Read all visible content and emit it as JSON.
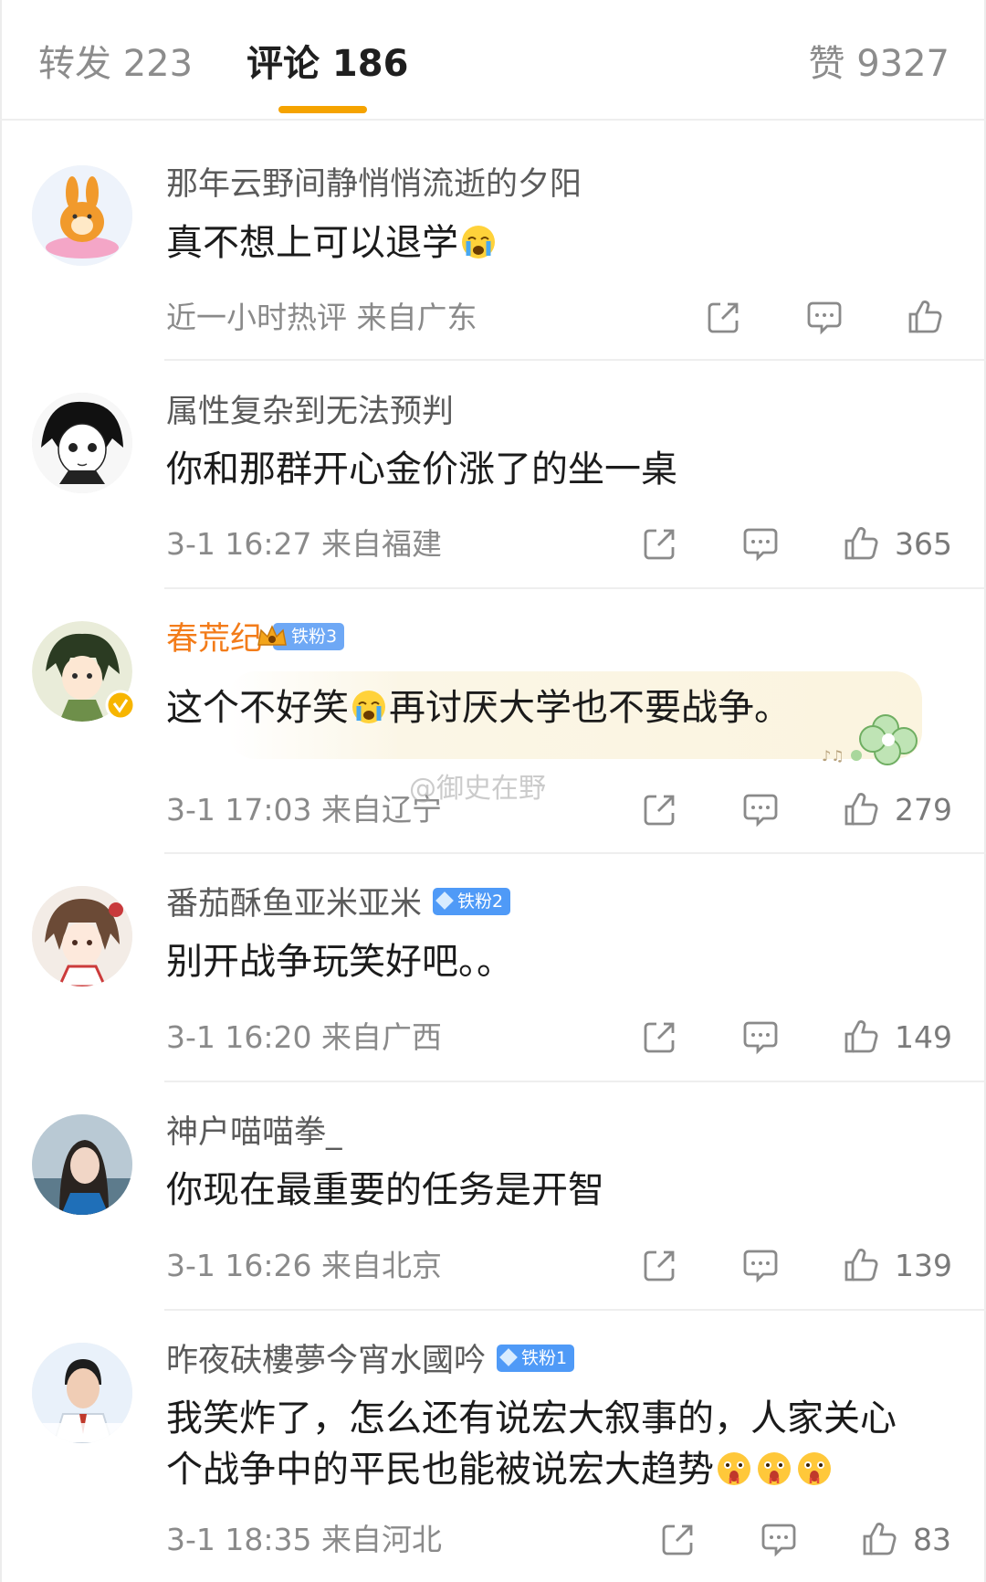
{
  "tabs": {
    "forward": "转发 223",
    "comments": "评论 186",
    "likes": "赞 9327"
  },
  "watermark": "@御史在野",
  "comments": [
    {
      "user": "那年云野间静悄悄流逝的夕阳",
      "text": "真不想上可以退学",
      "meta": "近一小时热评  来自广东",
      "likes": ""
    },
    {
      "user": "属性复杂到无法预判",
      "text": "你和那群开心金价涨了的坐一桌",
      "meta": "3-1 16:27  来自福建",
      "likes": "365"
    },
    {
      "user": "春荒纪",
      "badge": "铁粉3",
      "text_a": "这个不好笑",
      "text_b": "再讨厌大学也不要战争。",
      "meta": "3-1 17:03  来自辽宁",
      "likes": "279"
    },
    {
      "user": "番茄酥鱼亚米亚米",
      "badge": "铁粉2",
      "text": "别开战争玩笑好吧。。",
      "meta": "3-1 16:20  来自广西",
      "likes": "149"
    },
    {
      "user": "神户喵喵拳_",
      "text": "你现在最重要的任务是开智",
      "meta": "3-1 16:26  来自北京",
      "likes": "139"
    },
    {
      "user": "昨夜砆樓夢今宵水國吟",
      "badge": "铁粉1",
      "text": "我笑炸了，怎么还有说宏大叙事的，人家关心个战争中的平民也能被说宏大趋势",
      "meta": "3-1 18:35  来自河北",
      "likes": "83"
    }
  ],
  "colors": {
    "accent": "#f5a300",
    "vip_name": "#f37c1a",
    "badge": "#4f9af7"
  },
  "icons": [
    "share-icon",
    "comment-icon",
    "like-icon",
    "crying-emoji",
    "shocked-emoji"
  ]
}
